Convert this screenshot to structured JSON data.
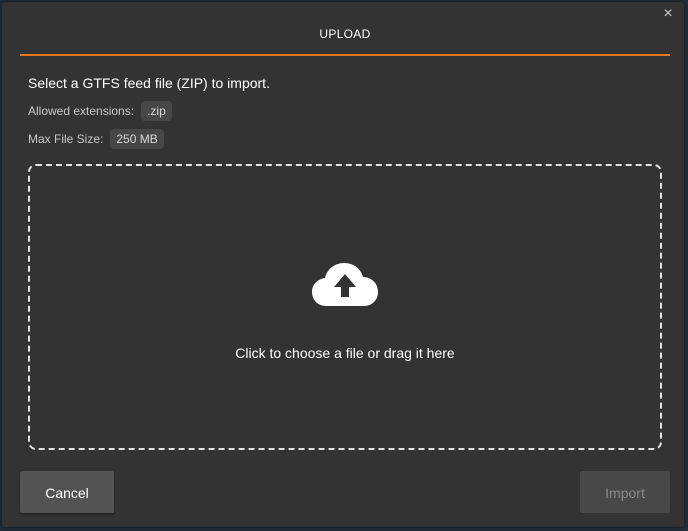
{
  "dialog": {
    "title": "UPLOAD",
    "close_glyph": "×",
    "instruction": "Select a GTFS feed file (ZIP) to import.",
    "allowed_extensions_label": "Allowed extensions:",
    "allowed_extensions_value": ".zip",
    "max_file_size_label": "Max File Size:",
    "max_file_size_value": "250 MB",
    "dropzone_text": "Click to choose a file or drag it here",
    "dropzone_icon": "cloud-upload-icon",
    "cancel_label": "Cancel",
    "import_label": "Import",
    "import_enabled": false
  },
  "colors": {
    "accent": "#e8781e",
    "modal_bg": "#333333",
    "tag_bg": "#474747"
  }
}
